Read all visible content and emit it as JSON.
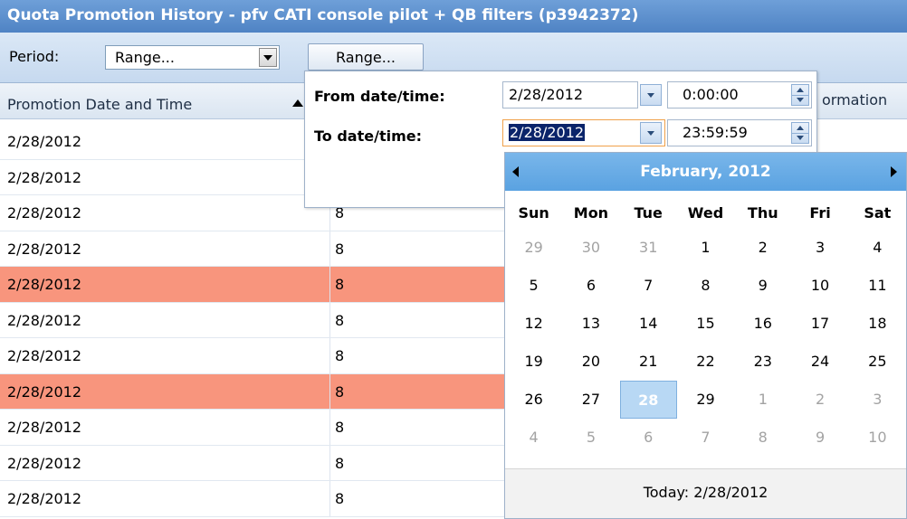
{
  "window": {
    "title": "Quota Promotion History - pfv CATI console pilot + QB filters (p3942372)"
  },
  "toolbar": {
    "period_label": "Period:",
    "period_value": "Range...",
    "range_button_label": "Range..."
  },
  "table": {
    "columns": [
      "Promotion Date and Time",
      "",
      "ormation"
    ],
    "rows": [
      {
        "date": "2/28/2012",
        "value": "",
        "highlight": false
      },
      {
        "date": "2/28/2012",
        "value": "",
        "highlight": false
      },
      {
        "date": "2/28/2012",
        "value": "8",
        "highlight": false
      },
      {
        "date": "2/28/2012",
        "value": "8",
        "highlight": false
      },
      {
        "date": "2/28/2012",
        "value": "8",
        "highlight": true
      },
      {
        "date": "2/28/2012",
        "value": "8",
        "highlight": false
      },
      {
        "date": "2/28/2012",
        "value": "8",
        "highlight": false
      },
      {
        "date": "2/28/2012",
        "value": "8",
        "highlight": true
      },
      {
        "date": "2/28/2012",
        "value": "8",
        "highlight": false
      },
      {
        "date": "2/28/2012",
        "value": "8",
        "highlight": false
      },
      {
        "date": "2/28/2012",
        "value": "8",
        "highlight": false
      }
    ],
    "highlight_color": "#f8957d"
  },
  "range_popup": {
    "from_label": "From date/time:",
    "from_date": "2/28/2012",
    "from_time": "0:00:00",
    "to_label": "To date/time:",
    "to_date": "2/28/2012",
    "to_time": "23:59:59"
  },
  "calendar": {
    "month_label": "February, 2012",
    "weekdays": [
      "Sun",
      "Mon",
      "Tue",
      "Wed",
      "Thu",
      "Fri",
      "Sat"
    ],
    "weeks": [
      [
        {
          "d": "29",
          "o": true
        },
        {
          "d": "30",
          "o": true
        },
        {
          "d": "31",
          "o": true
        },
        {
          "d": "1"
        },
        {
          "d": "2"
        },
        {
          "d": "3"
        },
        {
          "d": "4"
        }
      ],
      [
        {
          "d": "5"
        },
        {
          "d": "6"
        },
        {
          "d": "7"
        },
        {
          "d": "8"
        },
        {
          "d": "9"
        },
        {
          "d": "10"
        },
        {
          "d": "11"
        }
      ],
      [
        {
          "d": "12"
        },
        {
          "d": "13"
        },
        {
          "d": "14"
        },
        {
          "d": "15"
        },
        {
          "d": "16"
        },
        {
          "d": "17"
        },
        {
          "d": "18"
        }
      ],
      [
        {
          "d": "19"
        },
        {
          "d": "20"
        },
        {
          "d": "21"
        },
        {
          "d": "22"
        },
        {
          "d": "23"
        },
        {
          "d": "24"
        },
        {
          "d": "25"
        }
      ],
      [
        {
          "d": "26"
        },
        {
          "d": "27"
        },
        {
          "d": "28",
          "s": true
        },
        {
          "d": "29"
        },
        {
          "d": "1",
          "o": true
        },
        {
          "d": "2",
          "o": true
        },
        {
          "d": "3",
          "o": true
        }
      ],
      [
        {
          "d": "4",
          "o": true
        },
        {
          "d": "5",
          "o": true
        },
        {
          "d": "6",
          "o": true
        },
        {
          "d": "7",
          "o": true
        },
        {
          "d": "8",
          "o": true
        },
        {
          "d": "9",
          "o": true
        },
        {
          "d": "10",
          "o": true
        }
      ]
    ],
    "today_label": "Today: 2/28/2012",
    "header_color": "#5aa2e1"
  },
  "icons": {
    "sort": "sort-ascending-icon",
    "dropdown": "chevron-down-icon",
    "spinner": "spinner-icon",
    "prev": "prev-month-icon",
    "next": "next-month-icon"
  }
}
